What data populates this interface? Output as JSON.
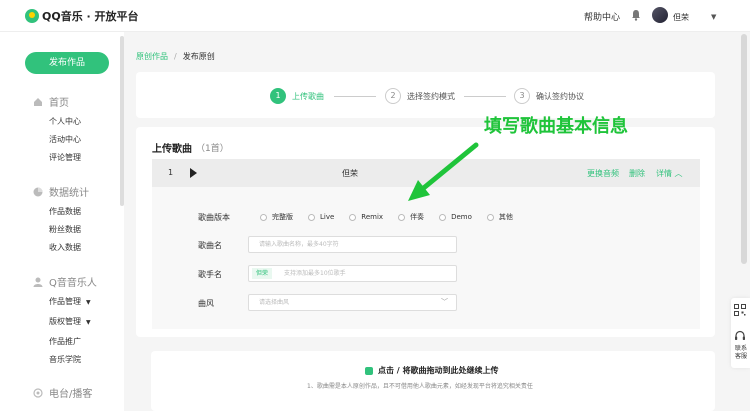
{
  "header": {
    "logo_text": "QQ音乐 · 开放平台",
    "help": "帮助中心",
    "username": "但荣"
  },
  "sidebar": {
    "publish_button": "发布作品",
    "sections": [
      {
        "title": "首页",
        "icon": "home-icon"
      },
      {
        "title": "数据统计",
        "icon": "pie-chart-icon"
      },
      {
        "title": "Q音音乐人",
        "icon": "user-icon"
      },
      {
        "title": "电台/播客",
        "icon": "radio-icon"
      }
    ],
    "items": {
      "personal_center": "个人中心",
      "activity_center": "活动中心",
      "comment_mgmt": "评论管理",
      "work_data": "作品数据",
      "fans_data": "粉丝数据",
      "income_data": "收入数据",
      "work_mgmt": "作品管理",
      "copyright_mgmt": "版权管理",
      "work_promo": "作品推广",
      "music_academy": "音乐学院"
    }
  },
  "breadcrumb": {
    "parent": "原创作品",
    "current": "发布原创"
  },
  "steps": [
    {
      "num": "1",
      "label": "上传歌曲",
      "active": true
    },
    {
      "num": "2",
      "label": "选择签约模式",
      "active": false
    },
    {
      "num": "3",
      "label": "确认签约协议",
      "active": false
    }
  ],
  "upload": {
    "title": "上传歌曲",
    "count": "（1首）",
    "song": {
      "index": "1",
      "name": "但荣",
      "actions": {
        "replace": "更换音频",
        "delete": "删除",
        "details": "详情"
      }
    },
    "form": {
      "version_label": "歌曲版本",
      "version_options": [
        "完整版",
        "Live",
        "Remix",
        "伴奏",
        "Demo",
        "其他"
      ],
      "name_label": "歌曲名",
      "name_placeholder": "请输入歌曲名称，最多40字符",
      "singer_label": "歌手名",
      "singer_tag": "但荣",
      "singer_placeholder": "支持添加最多10位歌手",
      "genre_label": "曲风",
      "genre_placeholder": "请选择曲风"
    }
  },
  "dropzone": {
    "main": "点击 / 将歌曲拖动到此处继续上传",
    "note": "1、歌曲需是本人原创作品，且不可借用他人歌曲元素，如经发现平台将追究相关责任"
  },
  "right_panel": {
    "contact": "联系客服"
  },
  "annotation": {
    "text": "填写歌曲基本信息",
    "color": "#1fc43a"
  },
  "colors": {
    "accent": "#31c27c"
  }
}
